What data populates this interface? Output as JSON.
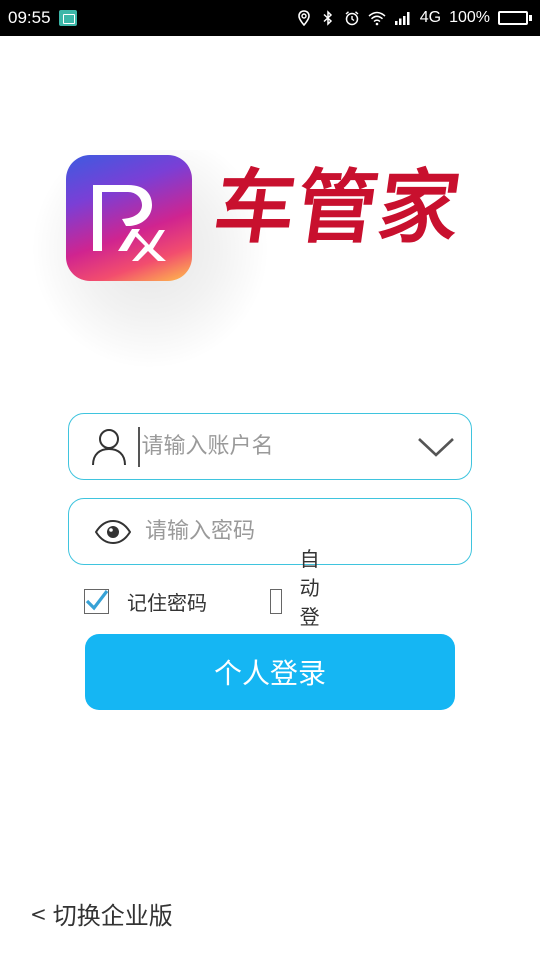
{
  "status_bar": {
    "time": "09:55",
    "network": "4G",
    "battery": "100%",
    "battery_level": 1.0,
    "icons": [
      "screenshot-icon",
      "location-icon",
      "bluetooth-icon",
      "alarm-icon",
      "wifi-icon",
      "signal-icon",
      "battery-icon"
    ]
  },
  "logo": {
    "brand_name": "车管家",
    "brand_color": "#c8102e"
  },
  "login_form": {
    "username": {
      "placeholder": "请输入账户名",
      "value": "",
      "icon": "user-icon",
      "dropdown_icon": "chevron-down-icon"
    },
    "password": {
      "placeholder": "请输入密码",
      "value": "",
      "icon": "eye-icon"
    },
    "remember_password": {
      "label": "记住密码",
      "checked": true
    },
    "auto_login": {
      "label": "自动登录",
      "checked": false
    },
    "submit_label": "个人登录",
    "accent_color": "#15b6f3",
    "field_border_color": "#3fc4de"
  },
  "footer": {
    "chevron": "<",
    "switch_label": "切换企业版"
  }
}
